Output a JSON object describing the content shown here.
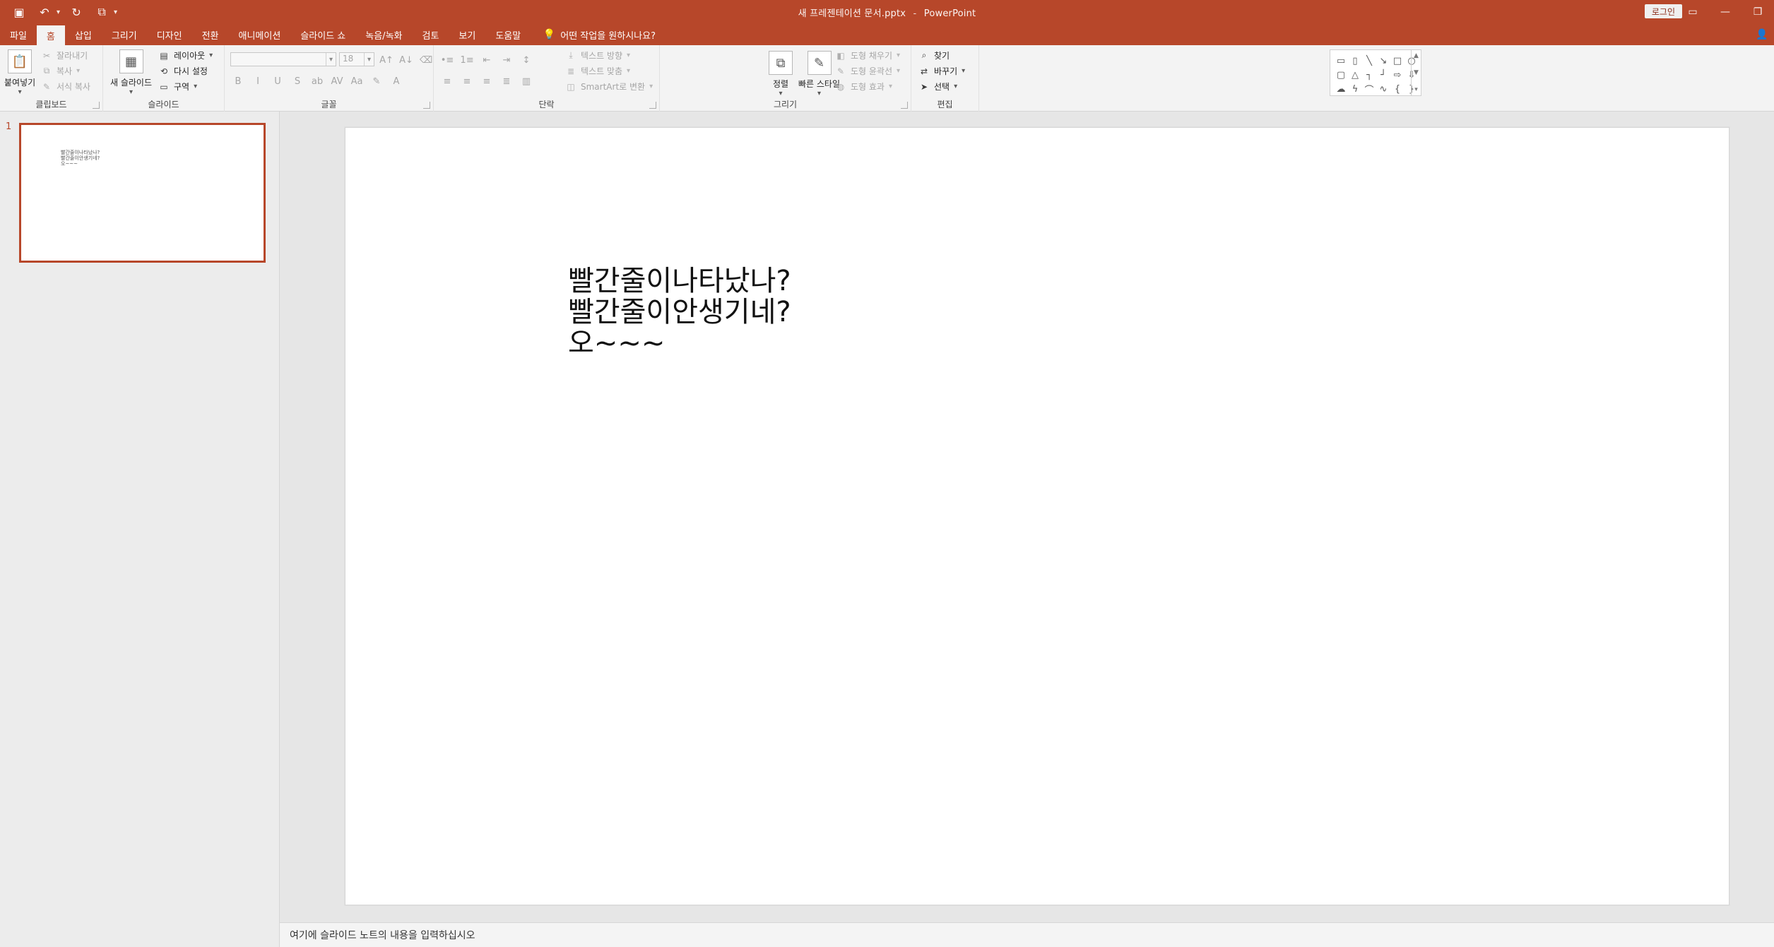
{
  "colors": {
    "accent": "#b7472a",
    "ribbon_bg": "#f3f3f3"
  },
  "window": {
    "document_title": "새 프레젠테이션 문서.pptx",
    "app_name": "PowerPoint",
    "login_label": "로그인"
  },
  "quick_access": {
    "icons": [
      "save-icon",
      "undo-icon",
      "redo-icon",
      "present-icon",
      "customize-icon"
    ]
  },
  "tabs": [
    {
      "label": "파일"
    },
    {
      "label": "홈"
    },
    {
      "label": "삽입"
    },
    {
      "label": "그리기"
    },
    {
      "label": "디자인"
    },
    {
      "label": "전환"
    },
    {
      "label": "애니메이션"
    },
    {
      "label": "슬라이드 쇼"
    },
    {
      "label": "녹음/녹화"
    },
    {
      "label": "검토"
    },
    {
      "label": "보기"
    },
    {
      "label": "도움말"
    }
  ],
  "tell_me": {
    "placeholder": "어떤 작업을 원하시나요?"
  },
  "ribbon": {
    "clipboard": {
      "group_label": "클립보드",
      "paste_label": "붙여넣기",
      "cut_label": "잘라내기",
      "copy_label": "복사",
      "format_painter_label": "서식 복사"
    },
    "slides": {
      "group_label": "슬라이드",
      "new_slide_label": "새 슬라이드",
      "layout_label": "레이아웃",
      "reset_label": "다시 설정",
      "section_label": "구역"
    },
    "font": {
      "group_label": "글꼴",
      "font_size_value": "18"
    },
    "paragraph": {
      "group_label": "단락",
      "text_direction_label": "텍스트 방향",
      "align_text_label": "텍스트 맞춤",
      "smartart_label": "SmartArt로 변환"
    },
    "drawing": {
      "group_label": "그리기",
      "arrange_label": "정렬",
      "quick_styles_label": "빠른 스타일",
      "shape_fill_label": "도형 채우기",
      "shape_outline_label": "도형 윤곽선",
      "shape_effects_label": "도형 효과"
    },
    "editing": {
      "group_label": "편집",
      "find_label": "찾기",
      "replace_label": "바꾸기",
      "select_label": "선택"
    }
  },
  "slides_pane": {
    "slide_number": "1",
    "thumbnail_text": "빨간줄이나타났나?\n빨간줄이안생기네?\n오~~~"
  },
  "slide": {
    "lines": [
      "빨간줄이나타났나?",
      "빨간줄이안생기네?",
      "오~~~"
    ]
  },
  "notes": {
    "placeholder": "여기에 슬라이드 노트의 내용을 입력하십시오"
  }
}
